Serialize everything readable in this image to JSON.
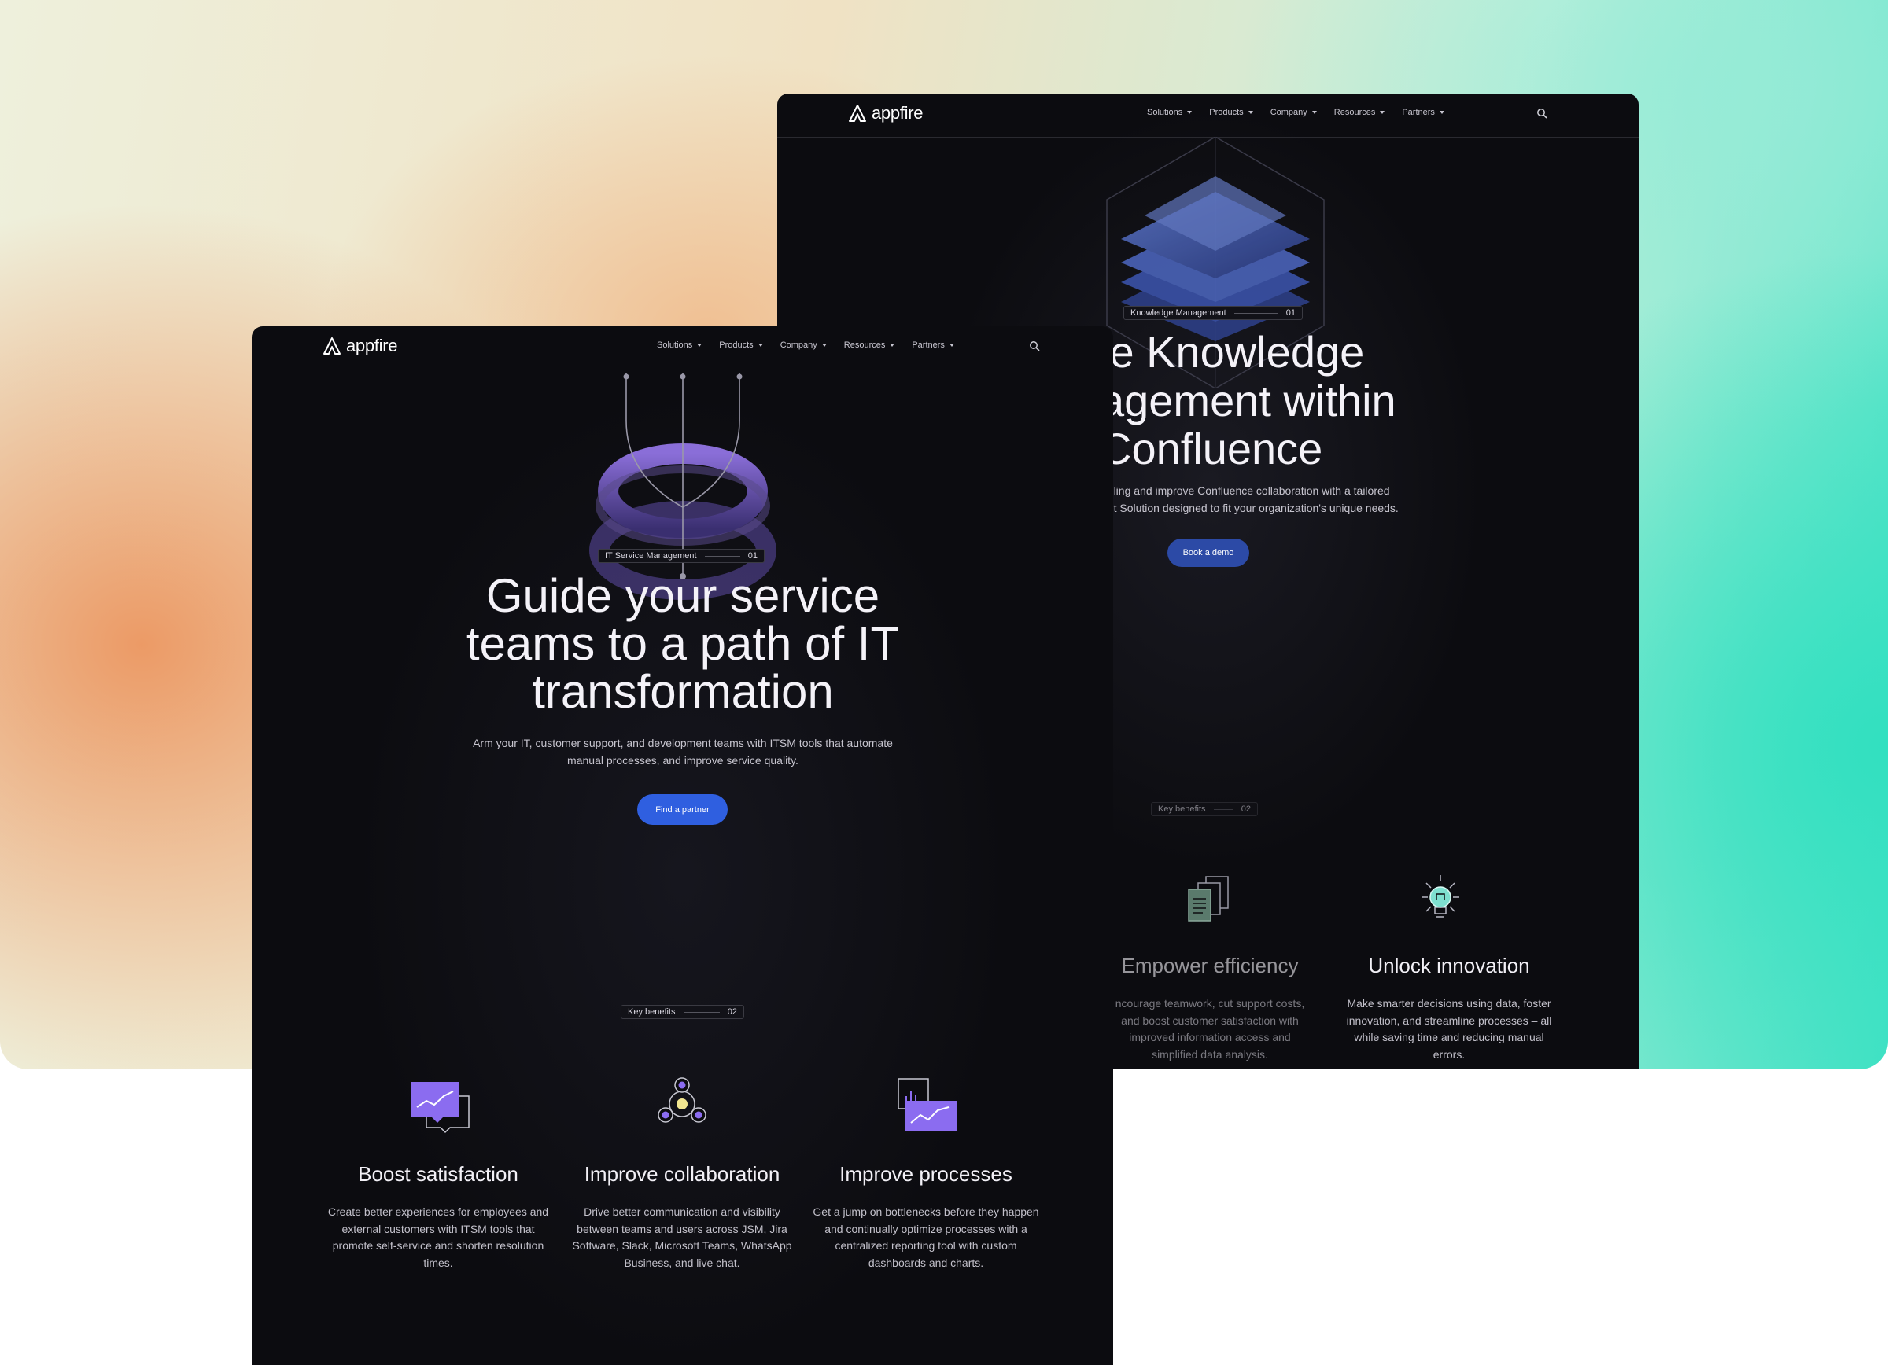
{
  "back_window": {
    "nav": {
      "logo": "appfire",
      "menu": [
        "Solutions",
        "Products",
        "Company",
        "Resources",
        "Partners"
      ]
    },
    "badge": {
      "label": "Knowledge Management",
      "num": "01"
    },
    "hero": {
      "line1": "le Knowledge",
      "line2": "agement within",
      "line3": "Confluence",
      "sub1": "ndling and improve Confluence collaboration with a tailored",
      "sub2": "ent Solution designed to fit your organization's unique needs."
    },
    "cta": "Book a demo",
    "benefits_badge": {
      "label": "Key benefits",
      "num": "02"
    },
    "features": [
      {
        "title": "Empower efficiency",
        "text": "ncourage teamwork, cut support costs, and boost customer satisfaction with improved information access and simplified data analysis.",
        "icon": "documents-icon"
      },
      {
        "title": "Unlock innovation",
        "text": "Make smarter decisions using data, foster innovation, and streamline processes – all while saving time and reducing manual errors.",
        "icon": "lightbulb-icon"
      }
    ]
  },
  "front_window": {
    "nav": {
      "logo": "appfire",
      "menu": [
        "Solutions",
        "Products",
        "Company",
        "Resources",
        "Partners"
      ]
    },
    "badge": {
      "label": "IT Service Management",
      "num": "01"
    },
    "hero": {
      "line1": "Guide your service",
      "line2": "teams to a path of IT",
      "line3": "transformation",
      "sub1": "Arm your IT, customer support, and development teams with ITSM tools that automate",
      "sub2": "manual processes, and improve service quality."
    },
    "cta": "Find a partner",
    "benefits_badge": {
      "label": "Key benefits",
      "num": "02"
    },
    "features": [
      {
        "title": "Boost satisfaction",
        "text": "Create better experiences for employees and external customers with ITSM tools that promote self-service and shorten resolution times.",
        "icon": "chart-chat-icon"
      },
      {
        "title": "Improve collaboration",
        "text": "Drive better communication and visibility between teams and users across JSM, Jira Software, Slack, Microsoft Teams, WhatsApp Business, and live chat.",
        "icon": "network-icon"
      },
      {
        "title": "Improve processes",
        "text": "Get a jump on bottlenecks before they happen and continually optimize processes with a centralized reporting tool with custom dashboards and charts.",
        "icon": "dashboard-icon"
      }
    ]
  },
  "colors": {
    "accent": "#2f5fe0",
    "panel": "#0c0c10",
    "purple": "#8b6cf0"
  }
}
